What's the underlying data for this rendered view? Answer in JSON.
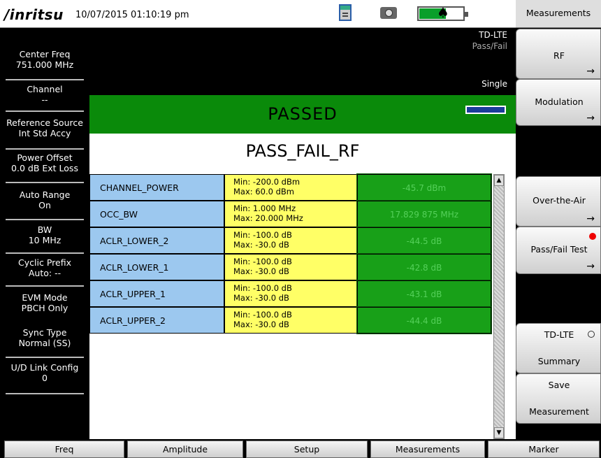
{
  "header": {
    "brand": "/inritsu",
    "datetime": "10/07/2015 01:10:19 pm",
    "battery_level": 0.62,
    "icons": [
      "save-icon",
      "camera-icon",
      "battery-icon",
      "plug-icon"
    ]
  },
  "left_panel": {
    "items": [
      {
        "label": "Center Freq",
        "value": "751.000 MHz"
      },
      {
        "label": "Channel",
        "value": "--"
      },
      {
        "label": "Reference Source",
        "value": "Int Std Accy"
      },
      {
        "label": "Power Offset",
        "value": "0.0 dB Ext Loss"
      },
      {
        "label": "Auto Range",
        "value": "On"
      },
      {
        "label": "BW",
        "value": "10 MHz"
      },
      {
        "label": "Cyclic Prefix",
        "value": "Auto: --"
      },
      {
        "label": "EVM Mode",
        "value": "PBCH Only"
      },
      {
        "label": "Sync Type",
        "value": "Normal (SS)"
      },
      {
        "label": "U/D Link Config",
        "value": "0"
      }
    ]
  },
  "main": {
    "mode": "TD-LTE",
    "submode": "Pass/Fail",
    "sweep": "Single",
    "status": "PASSED",
    "table_title": "PASS_FAIL_RF",
    "rows": [
      {
        "name": "CHANNEL_POWER",
        "min": "Min:  -200.0 dBm",
        "max": "Max:  60.0 dBm",
        "value": "-45.7 dBm"
      },
      {
        "name": "OCC_BW",
        "min": "Min:  1.000 MHz",
        "max": "Max:  20.000 MHz",
        "value": "17.829 875 MHz"
      },
      {
        "name": "ACLR_LOWER_2",
        "min": "Min:  -100.0 dB",
        "max": "Max:  -30.0 dB",
        "value": "-44.5 dB"
      },
      {
        "name": "ACLR_LOWER_1",
        "min": "Min:  -100.0 dB",
        "max": "Max:  -30.0 dB",
        "value": "-42.8 dB"
      },
      {
        "name": "ACLR_UPPER_1",
        "min": "Min:  -100.0 dB",
        "max": "Max:  -30.0 dB",
        "value": "-43.1 dB"
      },
      {
        "name": "ACLR_UPPER_2",
        "min": "Min:  -100.0 dB",
        "max": "Max:  -30.0 dB",
        "value": "-44.4 dB"
      }
    ],
    "scroll_up": "▲",
    "scroll_down": "▼"
  },
  "right_panel": {
    "title": "Measurements",
    "rf": "RF",
    "modulation": "Modulation",
    "over_the_air": "Over-the-Air",
    "pass_fail_test": "Pass/Fail Test",
    "tdlte": "TD-LTE",
    "summary": "Summary",
    "save": "Save",
    "measurement": "Measurement",
    "arrow": "→"
  },
  "bottom_tabs": [
    "Freq",
    "Amplitude",
    "Setup",
    "Measurements",
    "Marker"
  ],
  "colors": {
    "pass_green": "#0a8a0a",
    "name_blue": "#9cc8ef",
    "limit_yellow": "#ffff66",
    "value_green": "#18a018"
  }
}
